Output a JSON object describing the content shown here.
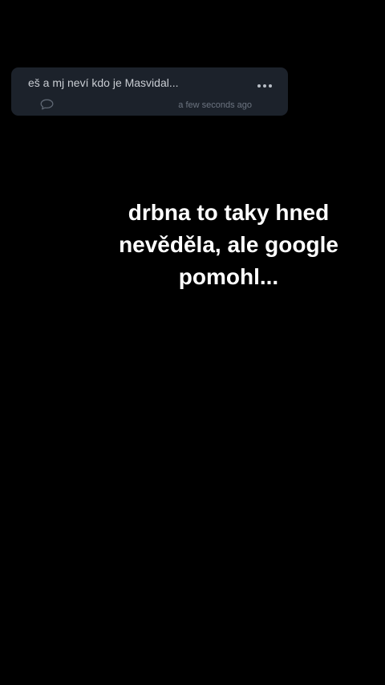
{
  "comment": {
    "text": "eš a mj neví kdo je Masvidal...",
    "timestamp": "a few seconds ago",
    "icons": {
      "reply": "speech-bubble-icon",
      "more": "more-options-icon"
    }
  },
  "story": {
    "lines": [
      "drbna to taky hned",
      "nevěděla, ale google",
      "pomohl..."
    ]
  },
  "colors": {
    "background": "#000000",
    "card": "#1c222b",
    "story_text": "#ffffff"
  }
}
